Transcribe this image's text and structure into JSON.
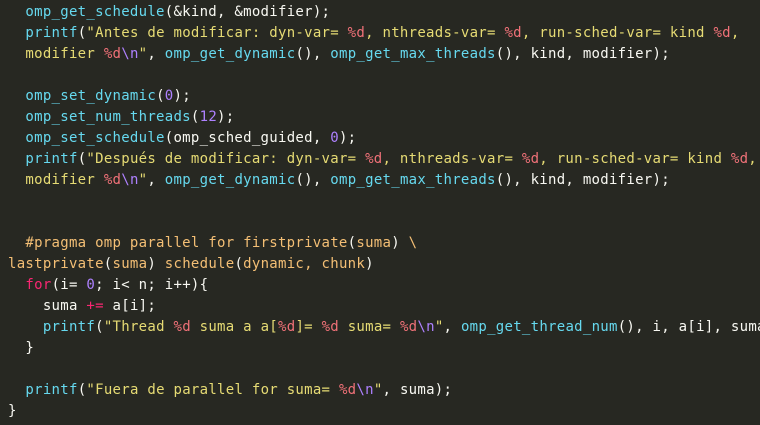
{
  "colors": {
    "background": "#272822",
    "default_text": "#f8f8f2",
    "function": "#66d9ef",
    "string": "#e6db74",
    "number": "#ae81ff",
    "keyword": "#f92672",
    "preprocessor": "#f4bf75",
    "format_specifier": "#f07178",
    "escape": "#ae81ff"
  },
  "code_lines": [
    [
      [
        "  ",
        "pl"
      ],
      [
        "omp_get_schedule",
        "fn"
      ],
      [
        "(&kind, &modifier);",
        "pl"
      ]
    ],
    [
      [
        "  ",
        "pl"
      ],
      [
        "printf",
        "fn"
      ],
      [
        "(",
        "pl"
      ],
      [
        "\"Antes de modificar: dyn-var= ",
        "str"
      ],
      [
        "%d",
        "fmt"
      ],
      [
        ", nthreads-var= ",
        "str"
      ],
      [
        "%d",
        "fmt"
      ],
      [
        ", run-sched-var= kind ",
        "str"
      ],
      [
        "%d",
        "fmt"
      ],
      [
        ",",
        "str"
      ]
    ],
    [
      [
        "  ",
        "pl"
      ],
      [
        "modifier ",
        "str"
      ],
      [
        "%d",
        "fmt"
      ],
      [
        "\\n",
        "esc"
      ],
      [
        "\"",
        "str"
      ],
      [
        ", ",
        "pl"
      ],
      [
        "omp_get_dynamic",
        "fn"
      ],
      [
        "(), ",
        "pl"
      ],
      [
        "omp_get_max_threads",
        "fn"
      ],
      [
        "(), kind, modifier);",
        "pl"
      ]
    ],
    [],
    [
      [
        "  ",
        "pl"
      ],
      [
        "omp_set_dynamic",
        "fn"
      ],
      [
        "(",
        "pl"
      ],
      [
        "0",
        "num"
      ],
      [
        ");",
        "pl"
      ]
    ],
    [
      [
        "  ",
        "pl"
      ],
      [
        "omp_set_num_threads",
        "fn"
      ],
      [
        "(",
        "pl"
      ],
      [
        "12",
        "num"
      ],
      [
        ");",
        "pl"
      ]
    ],
    [
      [
        "  ",
        "pl"
      ],
      [
        "omp_set_schedule",
        "fn"
      ],
      [
        "(omp_sched_guided, ",
        "pl"
      ],
      [
        "0",
        "num"
      ],
      [
        ");",
        "pl"
      ]
    ],
    [
      [
        "  ",
        "pl"
      ],
      [
        "printf",
        "fn"
      ],
      [
        "(",
        "pl"
      ],
      [
        "\"Después de modificar: dyn-var= ",
        "str"
      ],
      [
        "%d",
        "fmt"
      ],
      [
        ", nthreads-var= ",
        "str"
      ],
      [
        "%d",
        "fmt"
      ],
      [
        ", run-sched-var= kind ",
        "str"
      ],
      [
        "%d",
        "fmt"
      ],
      [
        ",",
        "str"
      ]
    ],
    [
      [
        "  ",
        "pl"
      ],
      [
        "modifier ",
        "str"
      ],
      [
        "%d",
        "fmt"
      ],
      [
        "\\n",
        "esc"
      ],
      [
        "\"",
        "str"
      ],
      [
        ", ",
        "pl"
      ],
      [
        "omp_get_dynamic",
        "fn"
      ],
      [
        "(), ",
        "pl"
      ],
      [
        "omp_get_max_threads",
        "fn"
      ],
      [
        "(), kind, modifier);",
        "pl"
      ]
    ],
    [],
    [],
    [
      [
        "  ",
        "pl"
      ],
      [
        "#pragma omp parallel for firstprivate",
        "kw2"
      ],
      [
        "(",
        "pl"
      ],
      [
        "suma",
        "kw2"
      ],
      [
        ") ",
        "pl"
      ],
      [
        "\\",
        "kw2"
      ]
    ],
    [
      [
        "lastprivate",
        "kw2"
      ],
      [
        "(",
        "pl"
      ],
      [
        "suma",
        "kw2"
      ],
      [
        ") ",
        "pl"
      ],
      [
        "schedule",
        "kw2"
      ],
      [
        "(",
        "pl"
      ],
      [
        "dynamic, chunk",
        "kw2"
      ],
      [
        ")",
        "pl"
      ]
    ],
    [
      [
        "  ",
        "pl"
      ],
      [
        "for",
        "kw"
      ],
      [
        "(i= ",
        "pl"
      ],
      [
        "0",
        "num"
      ],
      [
        "; i< n; i++){",
        "pl"
      ]
    ],
    [
      [
        "    suma ",
        "pl"
      ],
      [
        "+=",
        "kw"
      ],
      [
        " a[i];",
        "pl"
      ]
    ],
    [
      [
        "    ",
        "pl"
      ],
      [
        "printf",
        "fn"
      ],
      [
        "(",
        "pl"
      ],
      [
        "\"Thread ",
        "str"
      ],
      [
        "%d",
        "fmt"
      ],
      [
        " suma a a[",
        "str"
      ],
      [
        "%d",
        "fmt"
      ],
      [
        "]= ",
        "str"
      ],
      [
        "%d",
        "fmt"
      ],
      [
        " suma= ",
        "str"
      ],
      [
        "%d",
        "fmt"
      ],
      [
        "\\n",
        "esc"
      ],
      [
        "\"",
        "str"
      ],
      [
        ", ",
        "pl"
      ],
      [
        "omp_get_thread_num",
        "fn"
      ],
      [
        "(), i, a[i], suma);",
        "pl"
      ]
    ],
    [
      [
        "  }",
        "pl"
      ]
    ],
    [],
    [
      [
        "  ",
        "pl"
      ],
      [
        "printf",
        "fn"
      ],
      [
        "(",
        "pl"
      ],
      [
        "\"Fuera de parallel for suma= ",
        "str"
      ],
      [
        "%d",
        "fmt"
      ],
      [
        "\\n",
        "esc"
      ],
      [
        "\"",
        "str"
      ],
      [
        ", suma);",
        "pl"
      ]
    ],
    [
      [
        "}",
        "pl"
      ]
    ]
  ]
}
